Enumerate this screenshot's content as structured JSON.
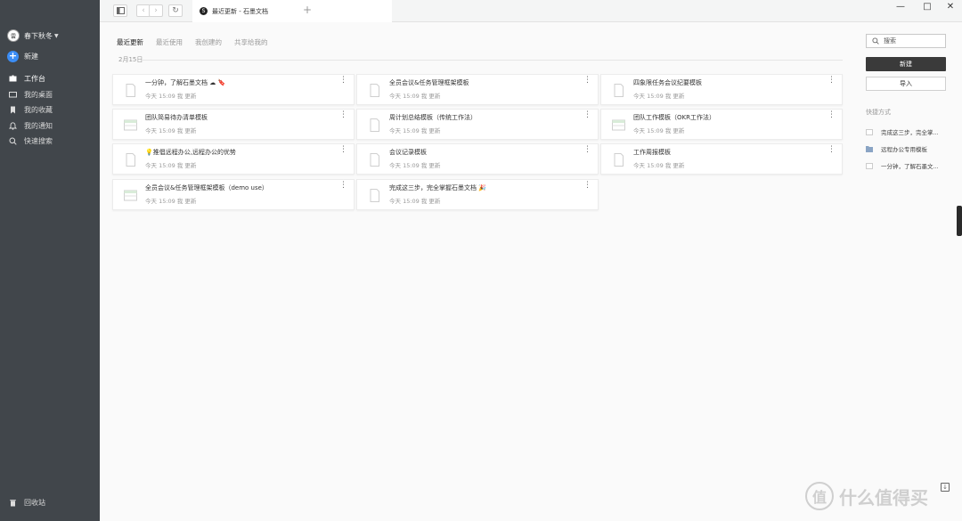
{
  "sidebar": {
    "user": {
      "avatar": "雲",
      "name": "春下秋冬"
    },
    "new_label": "新建",
    "items": [
      {
        "label": "工作台",
        "icon": "workspace-icon",
        "active": true
      },
      {
        "label": "我的桌面",
        "icon": "desktop-icon",
        "active": false
      },
      {
        "label": "我的收藏",
        "icon": "bookmark-icon",
        "active": false
      },
      {
        "label": "我的通知",
        "icon": "bell-icon",
        "active": false
      },
      {
        "label": "快速搜索",
        "icon": "search-icon",
        "active": false
      }
    ],
    "trash_label": "回收站"
  },
  "topbar": {
    "tab_logo": "S",
    "tab_title": "最近更新 - 石墨文档",
    "new_tab": "+",
    "minimize": "—",
    "maximize": "□",
    "close": "✕"
  },
  "filter_tabs": [
    "最近更新",
    "最近使用",
    "我创建的",
    "共享给我的"
  ],
  "date_label": "2月15日",
  "cards": [
    {
      "title": "一分钟，了解石墨文档 ☁ 🔖",
      "meta": "今天 15:09 我 更新",
      "type": "doc"
    },
    {
      "title": "全员会议&任务管理框架模板",
      "meta": "今天 15:09 我 更新",
      "type": "doc"
    },
    {
      "title": "四象限任务会议纪要模板",
      "meta": "今天 15:09 我 更新",
      "type": "doc"
    },
    {
      "title": "团队简易待办清单模板",
      "meta": "今天 15:09 我 更新",
      "type": "sheet"
    },
    {
      "title": "周计划总结模板（传统工作法）",
      "meta": "今天 15:09 我 更新",
      "type": "doc"
    },
    {
      "title": "团队工作模板（OKR工作法）",
      "meta": "今天 15:09 我 更新",
      "type": "sheet"
    },
    {
      "title": "💡推倡远程办公,远程办公的优势",
      "meta": "今天 15:09 我 更新",
      "type": "doc"
    },
    {
      "title": "会议记录模板",
      "meta": "今天 15:09 我 更新",
      "type": "doc"
    },
    {
      "title": "工作周报模板",
      "meta": "今天 15:09 我 更新",
      "type": "doc"
    },
    {
      "title": "全员会议&任务管理框架模板（demo use）",
      "meta": "今天 15:09 我 更新",
      "type": "sheet"
    },
    {
      "title": "完成这三步，完全掌握石墨文档 🎉",
      "meta": "今天 15:09 我 更新",
      "type": "doc"
    }
  ],
  "right": {
    "search_placeholder": "搜索",
    "create_label": "新建",
    "import_label": "导入",
    "quick_title": "快捷方式",
    "quick_items": [
      {
        "label": "完成这三步，完全掌...",
        "icon": "doc-icon"
      },
      {
        "label": "远程办公专用模板",
        "icon": "folder-icon"
      },
      {
        "label": "一分钟，了解石墨文...",
        "icon": "doc-icon"
      }
    ]
  },
  "watermark": {
    "icon": "值",
    "text": "什么值得买"
  },
  "colors": {
    "sidebar": "#41464b",
    "accent": "#3b8df5",
    "dark_button": "#3a3a3a"
  }
}
